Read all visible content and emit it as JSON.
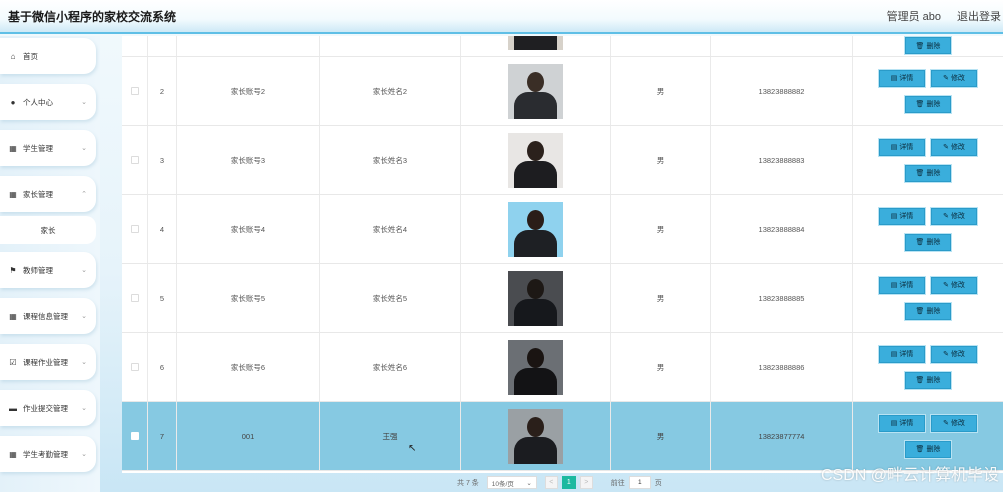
{
  "app": {
    "title": "基于微信小程序的家校交流系统"
  },
  "header": {
    "admin_label": "管理员 abo",
    "logout_label": "退出登录"
  },
  "sidebar": {
    "items": [
      {
        "label": "首页",
        "icon": "home-icon",
        "glyph": "⌂"
      },
      {
        "label": "个人中心",
        "icon": "user-icon",
        "glyph": "●"
      },
      {
        "label": "学生管理",
        "icon": "grid-icon",
        "glyph": "▦"
      },
      {
        "label": "家长管理",
        "icon": "grid-icon",
        "glyph": "▦"
      },
      {
        "label": "家长",
        "icon": "",
        "glyph": ""
      },
      {
        "label": "教师管理",
        "icon": "flag-icon",
        "glyph": "⚑"
      },
      {
        "label": "课程信息管理",
        "icon": "grid-icon",
        "glyph": "▦"
      },
      {
        "label": "课程作业管理",
        "icon": "checkbox-icon",
        "glyph": "☑"
      },
      {
        "label": "作业提交管理",
        "icon": "monitor-icon",
        "glyph": "▬"
      },
      {
        "label": "学生考勤管理",
        "icon": "grid-icon",
        "glyph": "▦"
      }
    ]
  },
  "table": {
    "rows": [
      {
        "index": "2",
        "account": "家长账号2",
        "name": "家长姓名2",
        "sex": "男",
        "phone": "13823888882"
      },
      {
        "index": "3",
        "account": "家长账号3",
        "name": "家长姓名3",
        "sex": "男",
        "phone": "13823888883"
      },
      {
        "index": "4",
        "account": "家长账号4",
        "name": "家长姓名4",
        "sex": "男",
        "phone": "13823888884"
      },
      {
        "index": "5",
        "account": "家长账号5",
        "name": "家长姓名5",
        "sex": "男",
        "phone": "13823888885"
      },
      {
        "index": "6",
        "account": "家长账号6",
        "name": "家长姓名6",
        "sex": "男",
        "phone": "13823888886"
      },
      {
        "index": "7",
        "account": "001",
        "name": "王强",
        "sex": "男",
        "phone": "13823877774"
      }
    ],
    "actions": {
      "detail": "详情",
      "edit": "修改",
      "delete": "删除"
    }
  },
  "pager": {
    "total": "共 7 条",
    "page_size": "10条/页",
    "prev": "<",
    "current": "1",
    "next": ">",
    "goto_label": "前往",
    "goto_value": "1",
    "unit": "页"
  },
  "watermark": "CSDN @畔云计算机毕设"
}
